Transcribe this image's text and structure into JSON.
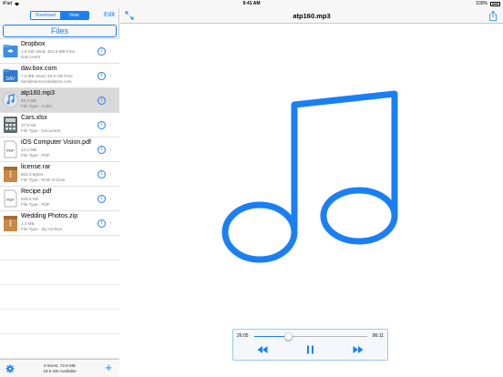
{
  "status_bar": {
    "device": "iPad",
    "time": "9:41 AM",
    "battery": "100%"
  },
  "sidebar": {
    "segments": [
      "Download",
      "View"
    ],
    "active_segment": "View",
    "edit_label": "Edit",
    "files_label": "Files",
    "items": [
      {
        "name": "Dropbox",
        "line1": "1.8 GB Used, 461.6 MB Free",
        "line2": "Dan Leehr",
        "icon": "dropbox-folder-icon",
        "selected": false
      },
      {
        "name": "dav.box.com",
        "line1": "7.5 MB Used, 50.0 GB Free",
        "line2": "dan@hammockdistrict.com",
        "icon": "webdav-server-icon",
        "selected": false
      },
      {
        "name": "atp160.mp3",
        "line1": "59.3 MB",
        "line2": "File Type : Audio",
        "icon": "audio-file-icon",
        "selected": true
      },
      {
        "name": "Cars.xlsx",
        "line1": "37.6 KB",
        "line2": "File Type : Document",
        "icon": "spreadsheet-file-icon",
        "selected": false
      },
      {
        "name": "iOS Computer Vision.pdf",
        "line1": "12.2 MB",
        "line2": "File Type : PDF",
        "icon": "pdf-file-icon",
        "selected": false
      },
      {
        "name": "license.rar",
        "line1": "602.0 Bytes",
        "line2": "File Type : RAR Archive",
        "icon": "archive-file-icon",
        "selected": false
      },
      {
        "name": "Recipe.pdf",
        "line1": "948.5 KB",
        "line2": "File Type : PDF",
        "icon": "pdf-file-icon",
        "selected": false
      },
      {
        "name": "Wedding Photos.zip",
        "line1": "1.4 MB",
        "line2": "File Type : Zip Archive",
        "icon": "archive-file-icon",
        "selected": false
      }
    ],
    "footer": {
      "line1": "8 Items, 73.9 MB",
      "line2": "18.5 GB Available"
    }
  },
  "main": {
    "title": "atp160.mp3",
    "player": {
      "elapsed": "26:05",
      "total": "86:11",
      "progress": 0.3
    }
  },
  "colors": {
    "accent": "#1a7ff3",
    "selected_row": "#d9d9d9",
    "sidebar_bg": "#f7f7f7"
  }
}
